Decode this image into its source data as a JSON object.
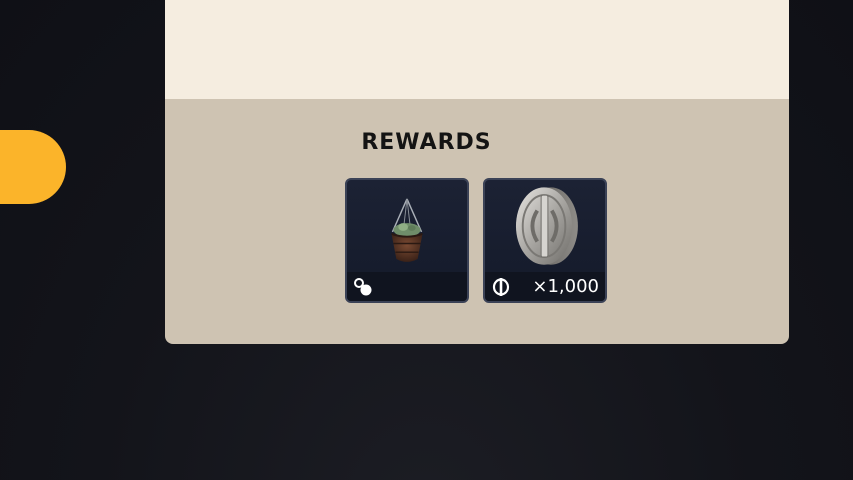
{
  "rewards": {
    "title": "REWARDS",
    "items": [
      {
        "icon": "hanging-planter-icon",
        "type_icon": "charm-icon",
        "quantity": ""
      },
      {
        "icon": "silver-coin-icon",
        "type_icon": "currency-icon",
        "quantity": "×1,000"
      }
    ]
  },
  "colors": {
    "accent": "#fbb42a",
    "panel_top": "#f5ede0",
    "panel_bottom": "#cec3b2",
    "card_bg": "#1c2234",
    "background": "#13141a"
  }
}
